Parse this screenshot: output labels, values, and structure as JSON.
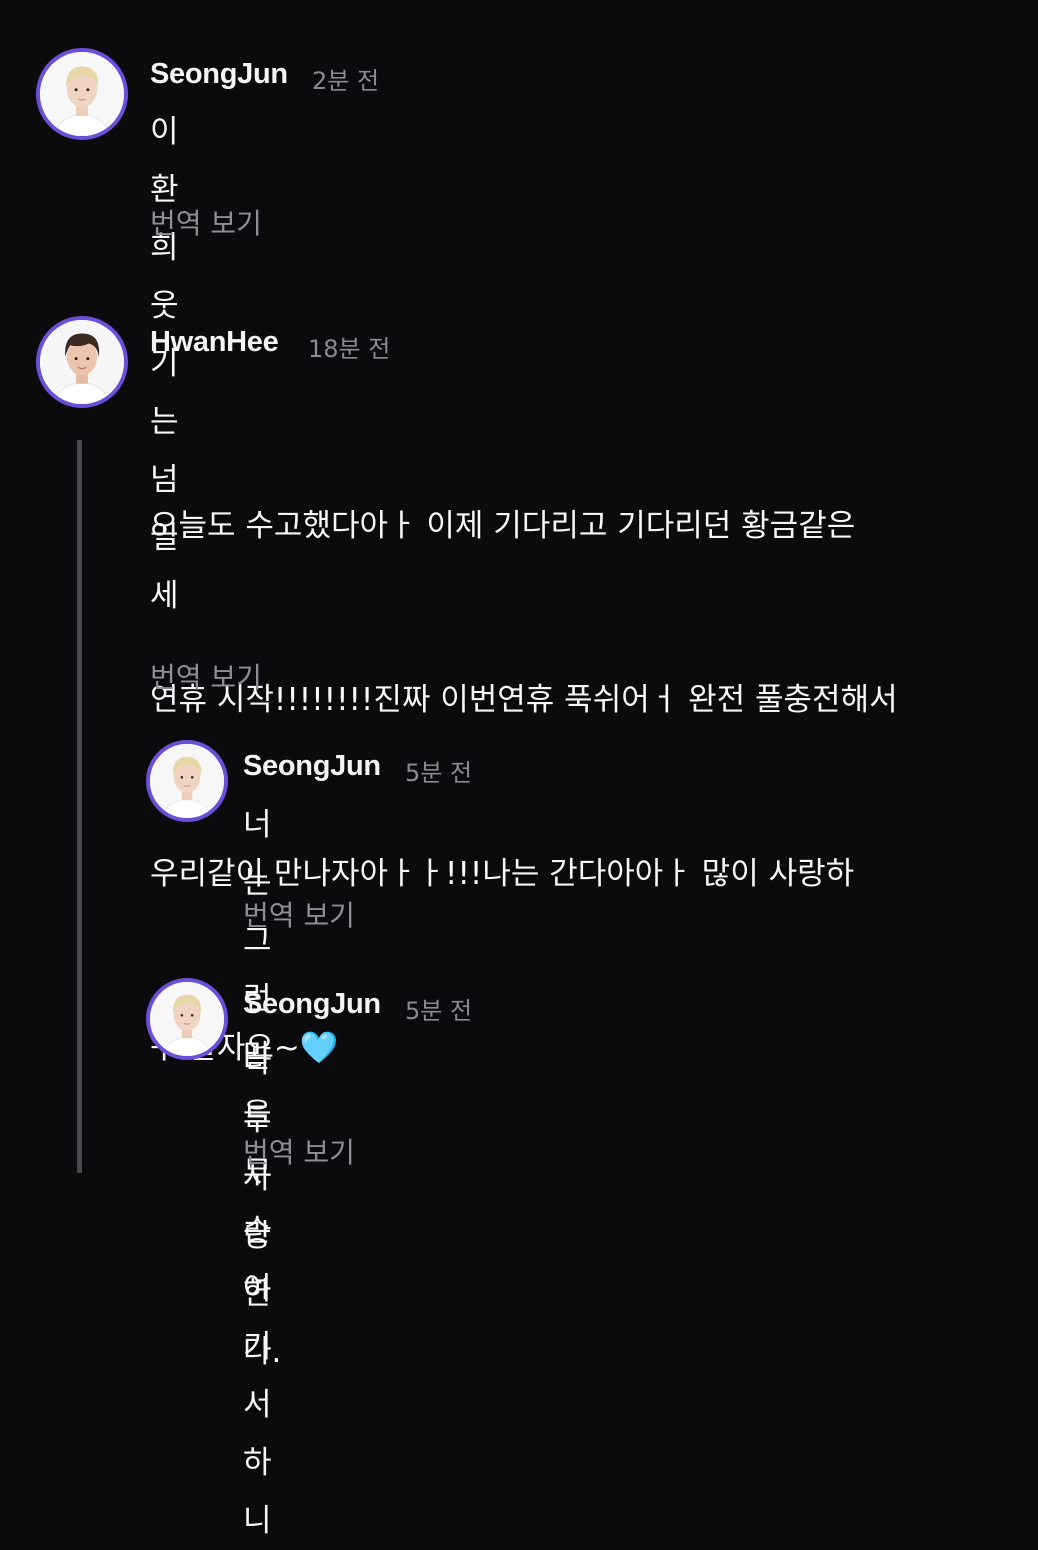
{
  "comments": [
    {
      "author": "SeongJun",
      "time": "2분 전",
      "text": "이환희 웃기는 넘일세",
      "translate": "번역 보기",
      "avatar_icon": "avatar-seongjun"
    },
    {
      "author": "HwanHee",
      "time": "18분 전",
      "lines": [
        "오늘도 수고했다아ㅏ 이제 기다리고 기다리던 황금같은",
        "연휴 시작!!!!!!!!진짜 이번연휴 푹쉬어ㅓ 완전 풀충전해서",
        "우리같이 만나자아ㅏㅏ!!!나는 간다아아ㅏ 많이 사랑하",
        "구 잘자요~"
      ],
      "emoji": "🩵",
      "translate": "번역 보기",
      "avatar_icon": "avatar-hwanhee"
    },
    {
      "author": "SeongJun",
      "time": "5분 전",
      "text": "너는 그런 말을 무슨 여기서 하니",
      "translate": "번역 보기",
      "avatar_icon": "avatar-seongjun"
    },
    {
      "author": "SeongJun",
      "time": "5분 전",
      "text": "나두 사랑한다.",
      "translate": "번역 보기",
      "avatar_icon": "avatar-seongjun"
    }
  ],
  "colors": {
    "background": "#0b0b0d",
    "avatar_ring": "#6b4fd8",
    "thread_line": "#4a4a4e",
    "muted_text": "#8a8a90"
  }
}
